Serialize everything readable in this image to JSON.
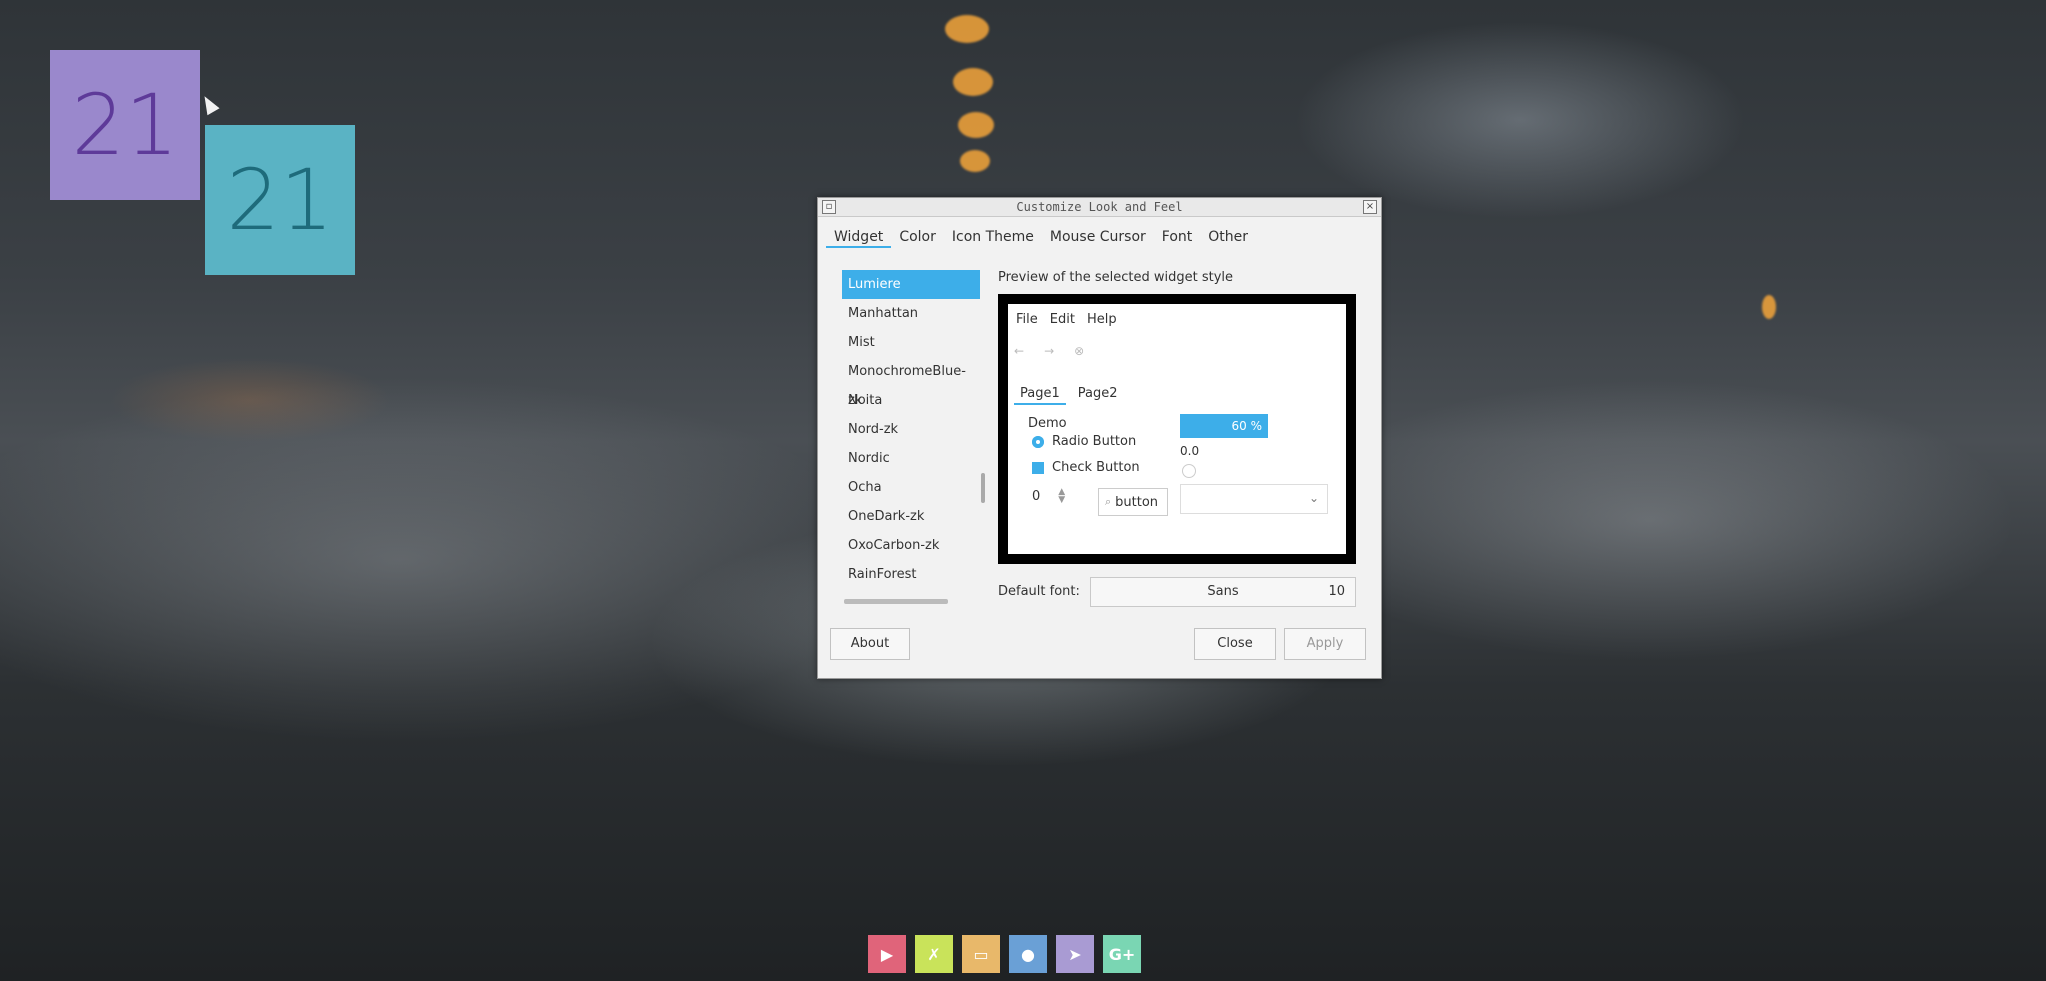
{
  "desktop": {
    "tile_purple_text": "21",
    "tile_teal_text": "21",
    "tile_purple_color": "#9a88cc",
    "tile_teal_color": "#5ab3c4"
  },
  "dialog": {
    "title": "Customize Look and Feel",
    "tabs": [
      {
        "label": "Widget"
      },
      {
        "label": "Color"
      },
      {
        "label": "Icon Theme"
      },
      {
        "label": "Mouse Cursor"
      },
      {
        "label": "Font"
      },
      {
        "label": "Other"
      }
    ],
    "themes": [
      "Lumiere",
      "Manhattan",
      "Mist",
      "MonochromeBlue-zk",
      "Noita",
      "Nord-zk",
      "Nordic",
      "Ocha",
      "OneDark-zk",
      "OxoCarbon-zk",
      "RainForest"
    ],
    "selected_theme": "Lumiere",
    "preview_label": "Preview of the selected widget style",
    "preview": {
      "menu": [
        "File",
        "Edit",
        "Help"
      ],
      "tabs": [
        "Page1",
        "Page2"
      ],
      "demo_label": "Demo",
      "radio_label": "Radio Button",
      "check_label": "Check Button",
      "spin_value": "0",
      "search_button": "button",
      "progress_text": "60 %",
      "slider_value": "0.0"
    },
    "font_label": "Default font:",
    "font_name": "Sans",
    "font_size": "10",
    "about_button": "About",
    "close_button": "Close",
    "apply_button": "Apply",
    "accent_color": "#3daee9"
  },
  "dock": {
    "items": [
      {
        "icon": "youtube-icon",
        "color": "#e0647a"
      },
      {
        "icon": "deviantart-icon",
        "color": "#c9e35a"
      },
      {
        "icon": "bag-icon",
        "color": "#e8b86a"
      },
      {
        "icon": "reddit-icon",
        "color": "#6aa0d6"
      },
      {
        "icon": "telegram-icon",
        "color": "#a99bd3"
      },
      {
        "icon": "google-plus-icon",
        "color": "#7ad6b3"
      }
    ]
  }
}
